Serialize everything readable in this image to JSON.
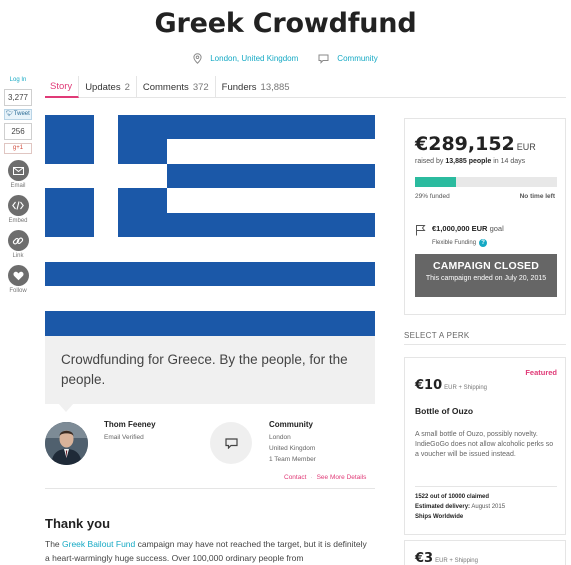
{
  "campaign": {
    "title": "Greek Crowdfund",
    "location": "London, United Kingdom",
    "category": "Community"
  },
  "share": {
    "login": "Log In",
    "like_count": "3,277",
    "tweet_label": "Tweet",
    "tweet_count": "256",
    "gplus_label": "g+1",
    "email_label": "Email",
    "embed_label": "Embed",
    "link_label": "Link",
    "follow_label": "Follow"
  },
  "tabs": [
    {
      "label": "Story",
      "count": ""
    },
    {
      "label": "Updates",
      "count": "2"
    },
    {
      "label": "Comments",
      "count": "372"
    },
    {
      "label": "Funders",
      "count": "13,885"
    }
  ],
  "pitch": "Crowdfunding for Greece. By the people, for the people.",
  "owner": {
    "name": "Thom Feeney",
    "verification": "Email Verified"
  },
  "team": {
    "title": "Community",
    "city": "London",
    "country": "United Kingdom",
    "members": "1 Team Member"
  },
  "links": {
    "contact": "Contact",
    "details": "See More Details"
  },
  "story": {
    "heading": "Thank you",
    "lead": "The ",
    "link": "Greek Bailout Fund",
    "body": " campaign may have not reached the target, but it is definitely a heart-warmingly huge success. Over 100,000 ordinary people from"
  },
  "funding": {
    "amount": "€289,152",
    "currency": "EUR",
    "raised_prefix": "raised by ",
    "people": "13,885 people",
    "raised_suffix": " in 14 days",
    "percent_funded": 29,
    "funded_label": "29% funded",
    "time_left": "No time left",
    "goal": "€1,000,000 EUR",
    "goal_word": "goal",
    "funding_type": "Flexible Funding",
    "closed_title": "CAMPAIGN CLOSED",
    "closed_sub": "This campaign ended on July 20, 2015",
    "accent_color": "#2bbb9f"
  },
  "perks": {
    "heading": "SELECT A PERK",
    "featured_label": "Featured",
    "items": [
      {
        "price": "€10",
        "shipping": "EUR + Shipping",
        "title": "Bottle of Ouzo",
        "description": "A small bottle of Ouzo, possibly novelty. IndieGoGo does not allow alcoholic perks so a voucher will be issued instead.",
        "claimed": "1522 out of 10000 claimed",
        "delivery_label": "Estimated delivery:",
        "delivery_value": "August 2015",
        "ships": "Ships Worldwide"
      },
      {
        "price": "€3",
        "shipping": "EUR + Shipping"
      }
    ]
  },
  "colors": {
    "brand_pink": "#e03a77",
    "link_teal": "#15a9c4",
    "flag_blue": "#1b58a8"
  }
}
